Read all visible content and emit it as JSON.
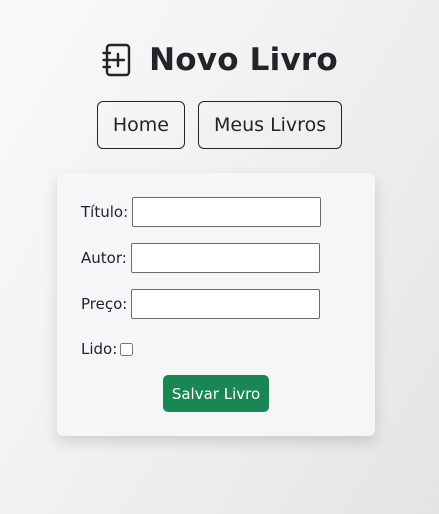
{
  "header": {
    "icon": "journal-plus-icon",
    "title": "Novo Livro"
  },
  "nav": {
    "home_label": "Home",
    "my_books_label": "Meus Livros"
  },
  "form": {
    "title_label": "Título:",
    "title_value": "",
    "author_label": "Autor:",
    "author_value": "",
    "price_label": "Preço:",
    "price_value": "",
    "read_label": "Lido:",
    "read_checked": false,
    "save_label": "Salvar Livro"
  },
  "colors": {
    "text": "#212529",
    "save_button": "#198754",
    "card_background": "#f5f6f8"
  }
}
